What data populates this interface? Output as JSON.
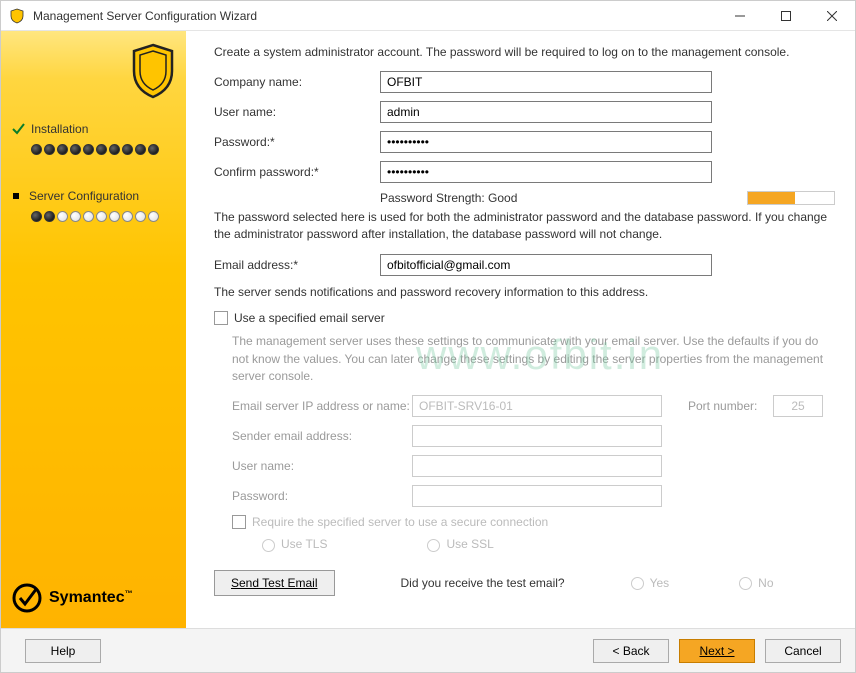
{
  "window": {
    "title": "Management Server Configuration Wizard"
  },
  "sidebar": {
    "steps": [
      {
        "label": "Installation"
      },
      {
        "label": "Server Configuration"
      }
    ],
    "brand": "Symantec"
  },
  "intro": "Create a system administrator account. The password will be required to log on to the management console.",
  "form": {
    "company_label": "Company name:",
    "company_value": "OFBIT",
    "user_label": "User name:",
    "user_value": "admin",
    "password_label": "Password:*",
    "password_value": "••••••••••",
    "confirm_label": "Confirm password:*",
    "confirm_value": "••••••••••",
    "pwstrength_label": "Password Strength: Good",
    "pwnote": "The password selected here is used for both the administrator password and the database password. If you change the administrator password after installation, the database password will not change.",
    "email_label": "Email address:*",
    "email_value": "ofbitofficial@gmail.com",
    "email_note": "The server sends notifications and password recovery information to this address."
  },
  "emailsrv": {
    "use_label": "Use a specified email server",
    "note": "The management server uses these settings to communicate with your email server.  Use the defaults if you do not know the values. You can later change these settings by editing the server properties from the management server console.",
    "server_label": "Email server IP address or name:",
    "server_value": "OFBIT-SRV16-01",
    "port_label": "Port number:",
    "port_value": "25",
    "sender_label": "Sender email address:",
    "user_label": "User name:",
    "pwd_label": "Password:",
    "secure_label": "Require the specified server to use a secure connection",
    "tls_label": "Use TLS",
    "ssl_label": "Use SSL"
  },
  "test": {
    "send_label": "Send Test Email",
    "question": "Did you receive the test email?",
    "yes": "Yes",
    "no": "No"
  },
  "footer": {
    "help": "Help",
    "back": "< Back",
    "next": "Next >",
    "cancel": "Cancel"
  },
  "watermark": "www.ofbit.in"
}
